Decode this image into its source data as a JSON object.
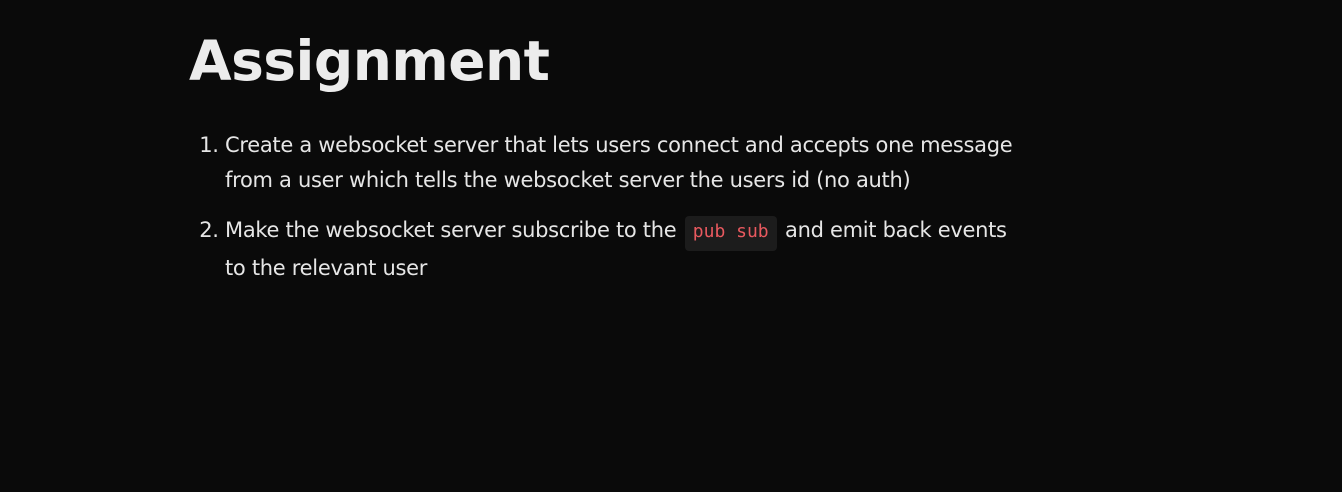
{
  "heading": "Assignment",
  "items": [
    {
      "text": "Create a websocket server that lets users connect and accepts one message from a user which tells the websocket server the users id (no auth)"
    },
    {
      "text_before": "Make the websocket server subscribe to the",
      "code": "pub sub",
      "text_after": "and emit back events to the relevant user"
    }
  ],
  "colors": {
    "background": "#0a0a0a",
    "text": "#e6e6e6",
    "inline_code_text": "#e8595f",
    "inline_code_background": "#1c1c1c"
  }
}
